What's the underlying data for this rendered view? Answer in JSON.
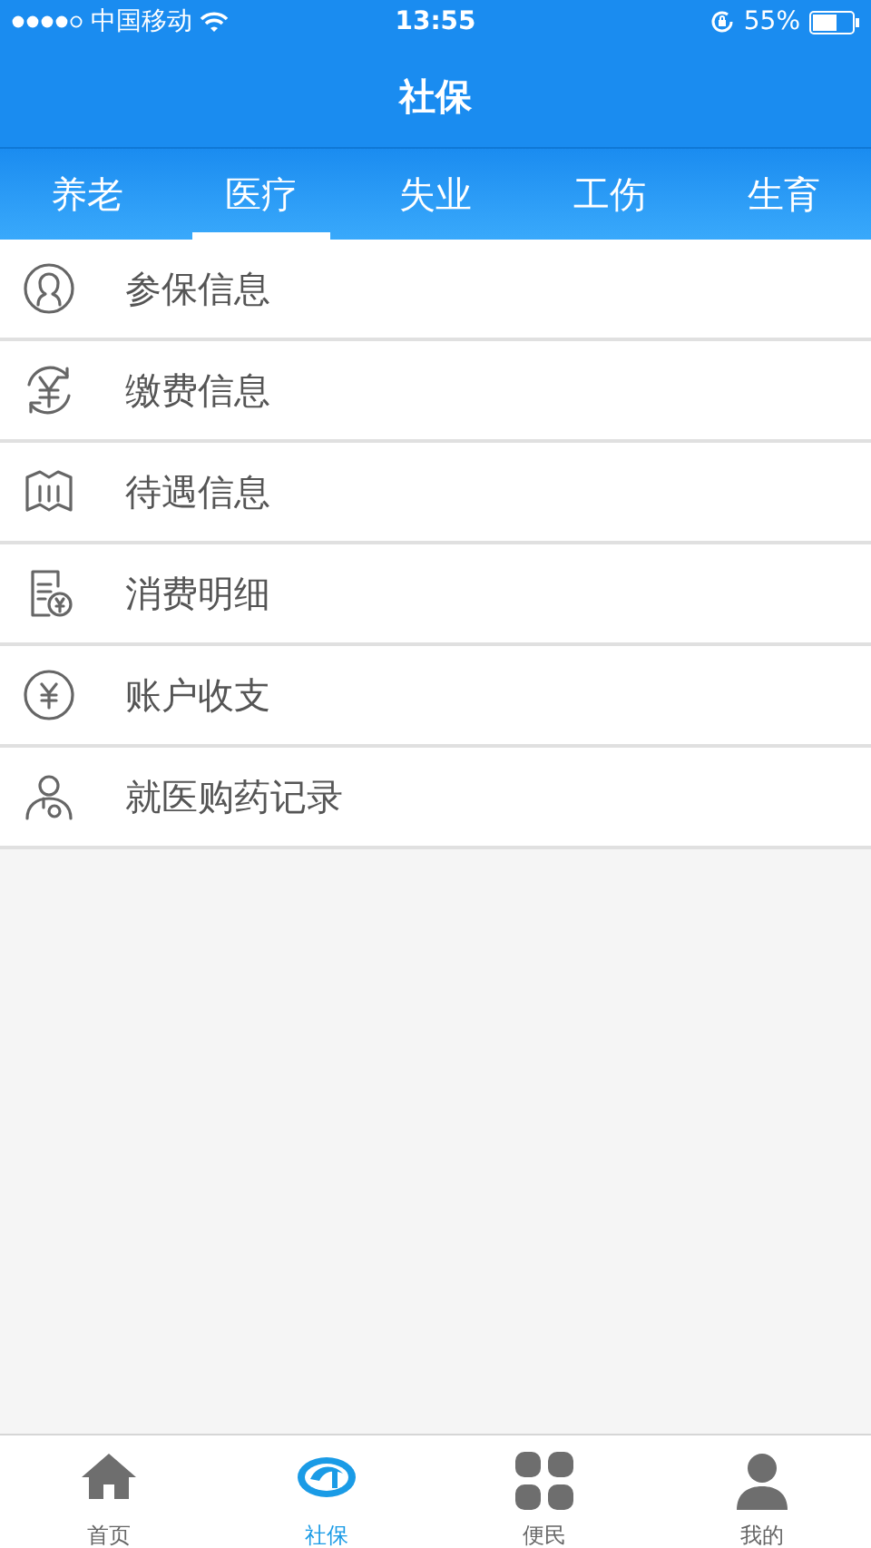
{
  "status_bar": {
    "carrier": "中国移动",
    "time": "13:55",
    "battery": "55%"
  },
  "header": {
    "title": "社保"
  },
  "tabs": [
    {
      "label": "养老",
      "selected": false
    },
    {
      "label": "医疗",
      "selected": true
    },
    {
      "label": "失业",
      "selected": false
    },
    {
      "label": "工伤",
      "selected": false
    },
    {
      "label": "生育",
      "selected": false
    }
  ],
  "menu": [
    {
      "label": "参保信息"
    },
    {
      "label": "缴费信息"
    },
    {
      "label": "待遇信息"
    },
    {
      "label": "消费明细"
    },
    {
      "label": "账户收支"
    },
    {
      "label": "就医购药记录"
    }
  ],
  "bottom_nav": [
    {
      "label": "首页",
      "selected": false
    },
    {
      "label": "社保",
      "selected": true
    },
    {
      "label": "便民",
      "selected": false
    },
    {
      "label": "我的",
      "selected": false
    }
  ]
}
